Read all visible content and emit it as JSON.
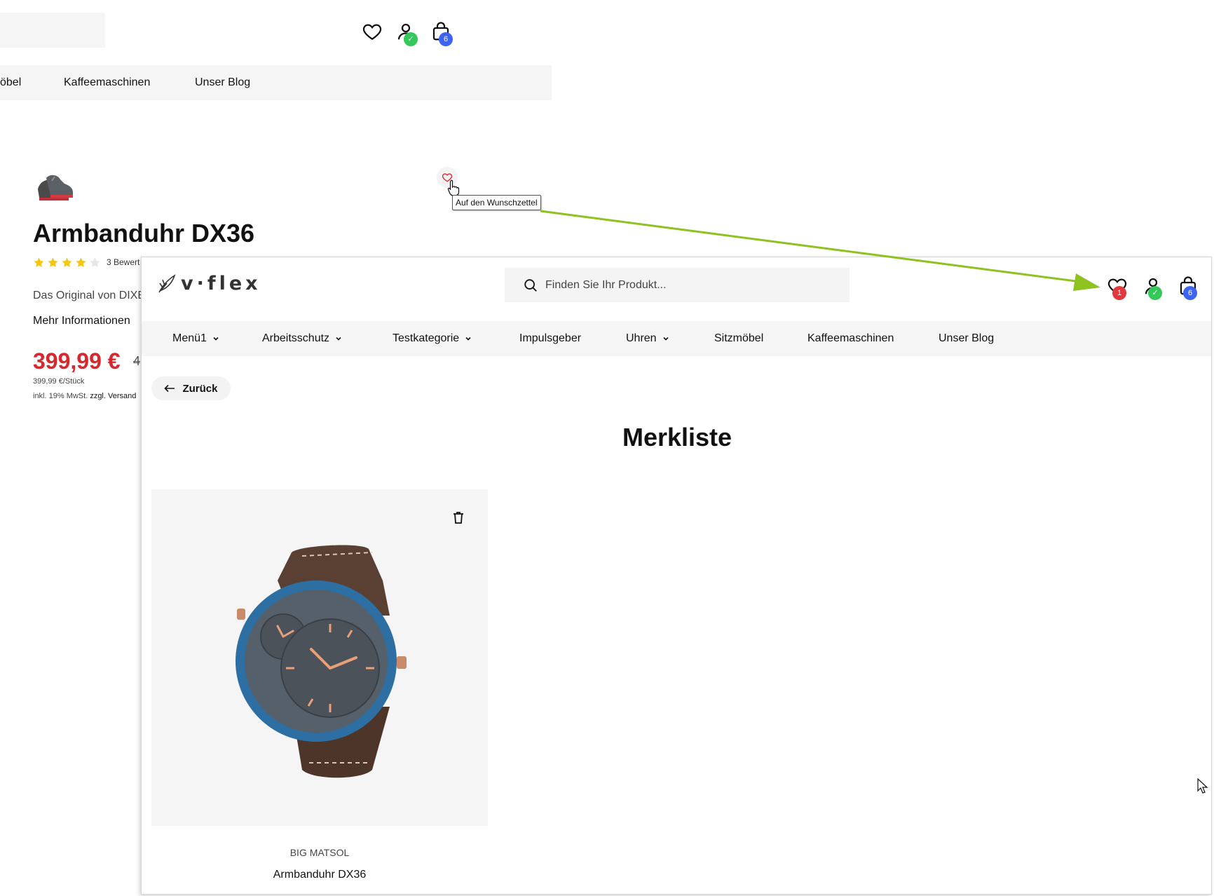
{
  "background_page": {
    "nav_items": [
      "öbel",
      "Kaffeemaschinen",
      "Unser Blog"
    ],
    "product_title": "Armbanduhr DX36",
    "rating_stars": 4,
    "rating_max": 5,
    "review_text": "3 Bewert",
    "description": "Das Original von DIXE",
    "more_info": "Mehr Informationen",
    "price": "399,99 €",
    "old_price": "4",
    "unit_price": "399,99 €/Stück",
    "tax_prefix": "inkl. 19% MwSt.",
    "tax_shipping": "zzgl. Versand",
    "cart_count": "6",
    "tooltip": "Auf den Wunschzettel"
  },
  "wishlist_page": {
    "brand": "v·flex",
    "search_placeholder": "Finden Sie Ihr Produkt...",
    "wishlist_count": "1",
    "cart_count": "6",
    "nav": [
      {
        "label": "Menü1",
        "dropdown": true
      },
      {
        "label": "Arbeitsschutz",
        "dropdown": true
      },
      {
        "label": "Testkategorie",
        "dropdown": true
      },
      {
        "label": "Impulsgeber",
        "dropdown": false
      },
      {
        "label": "Uhren",
        "dropdown": true
      },
      {
        "label": "Sitzmöbel",
        "dropdown": false
      },
      {
        "label": "Kaffeemaschinen",
        "dropdown": false
      },
      {
        "label": "Unser Blog",
        "dropdown": false
      }
    ],
    "back_label": "Zurück",
    "title": "Merkliste",
    "items": [
      {
        "brand": "BIG MATSOL",
        "name": "Armbanduhr DX36"
      }
    ]
  },
  "colors": {
    "price_red": "#d9272e",
    "badge_red": "#e0383e",
    "badge_green": "#34c759",
    "badge_blue": "#3d63f5",
    "star_yellow": "#f5c518",
    "arrow_green": "#8dc21f"
  }
}
